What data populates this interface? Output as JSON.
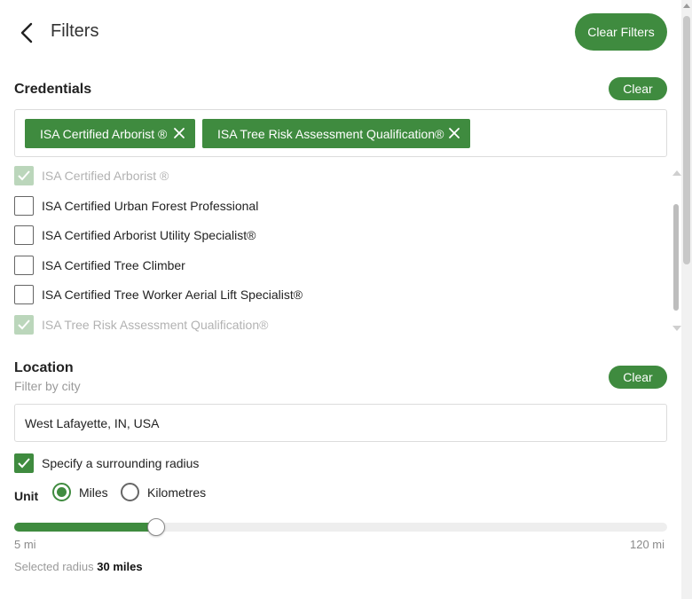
{
  "header": {
    "title": "Filters",
    "clear_filters_label": "Clear Filters"
  },
  "credentials": {
    "title": "Credentials",
    "clear_label": "Clear",
    "selected_chips": [
      "ISA Certified Arborist ®",
      "ISA Tree Risk Assessment Qualification®"
    ],
    "options": [
      {
        "label": "ISA Certified Arborist ®",
        "checked": true,
        "disabled": true
      },
      {
        "label": "ISA Certified Urban Forest Professional",
        "checked": false,
        "disabled": false
      },
      {
        "label": "ISA Certified Arborist Utility Specialist®",
        "checked": false,
        "disabled": false
      },
      {
        "label": "ISA Certified Tree Climber",
        "checked": false,
        "disabled": false
      },
      {
        "label": "ISA Certified Tree Worker Aerial Lift Specialist®",
        "checked": false,
        "disabled": false
      },
      {
        "label": "ISA Tree Risk Assessment Qualification®",
        "checked": true,
        "disabled": true
      }
    ]
  },
  "location": {
    "title": "Location",
    "subtitle": "Filter by city",
    "clear_label": "Clear",
    "input_value": "West Lafayette, IN, USA",
    "radius_toggle_label": "Specify a surrounding radius",
    "radius_toggle_checked": true,
    "unit_label": "Unit",
    "units": [
      {
        "label": "Miles",
        "selected": true
      },
      {
        "label": "Kilometres",
        "selected": false
      }
    ],
    "slider": {
      "min": 5,
      "max": 120,
      "value": 30,
      "min_label": "5 mi",
      "max_label": "120 mi"
    },
    "selected_radius_prefix": "Selected radius",
    "selected_radius_value": "30 miles"
  },
  "colors": {
    "accent": "#3f8b3f",
    "border": "#dcdcdc",
    "muted_text": "#9a9a9a"
  },
  "icons": {
    "back": "chevron-left-icon",
    "chip_remove": "close-icon",
    "check": "check-icon"
  }
}
